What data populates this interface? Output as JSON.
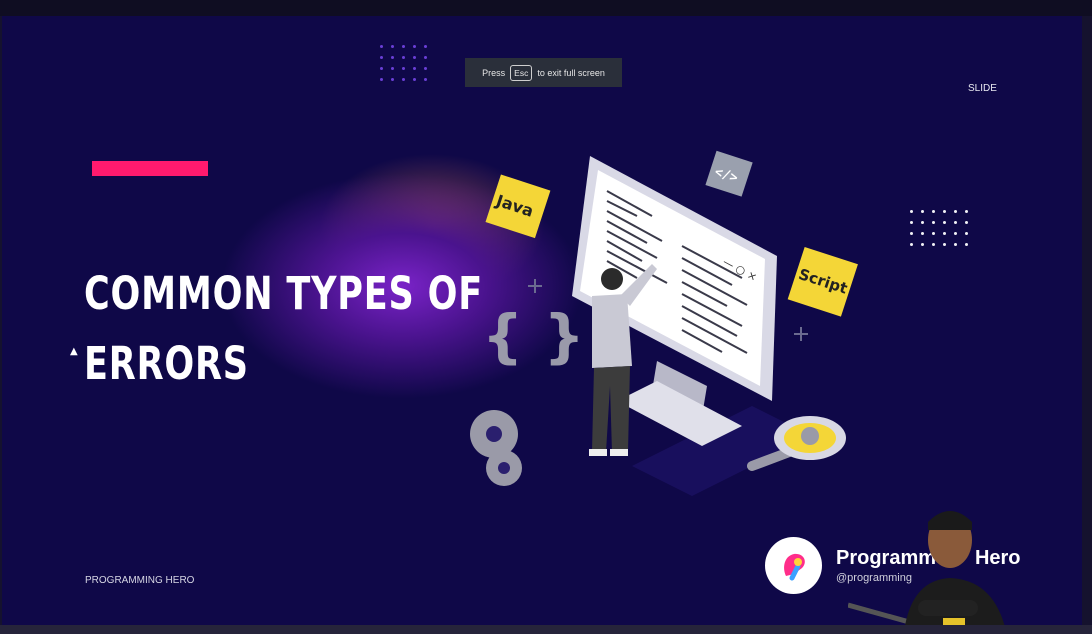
{
  "fullscreen_notice": {
    "prefix": "Press",
    "key": "Esc",
    "suffix": "to exit full screen"
  },
  "slide": {
    "tag": "SLIDE",
    "title_line1": "COMMON TYPES OF",
    "title_line2": "ERRORS",
    "footer": "PROGRAMMING HERO",
    "accent_color": "#ff1a6e",
    "background_color": "#0f0848"
  },
  "illustration": {
    "java_label": "Java",
    "script_label": "Script",
    "code_tag_label": "</>",
    "braces_label": "{ }",
    "window_controls": "— ○ ×"
  },
  "watermark": {
    "name_prefix": "Programm",
    "name_suffix": "Hero",
    "handle": "@programming"
  }
}
